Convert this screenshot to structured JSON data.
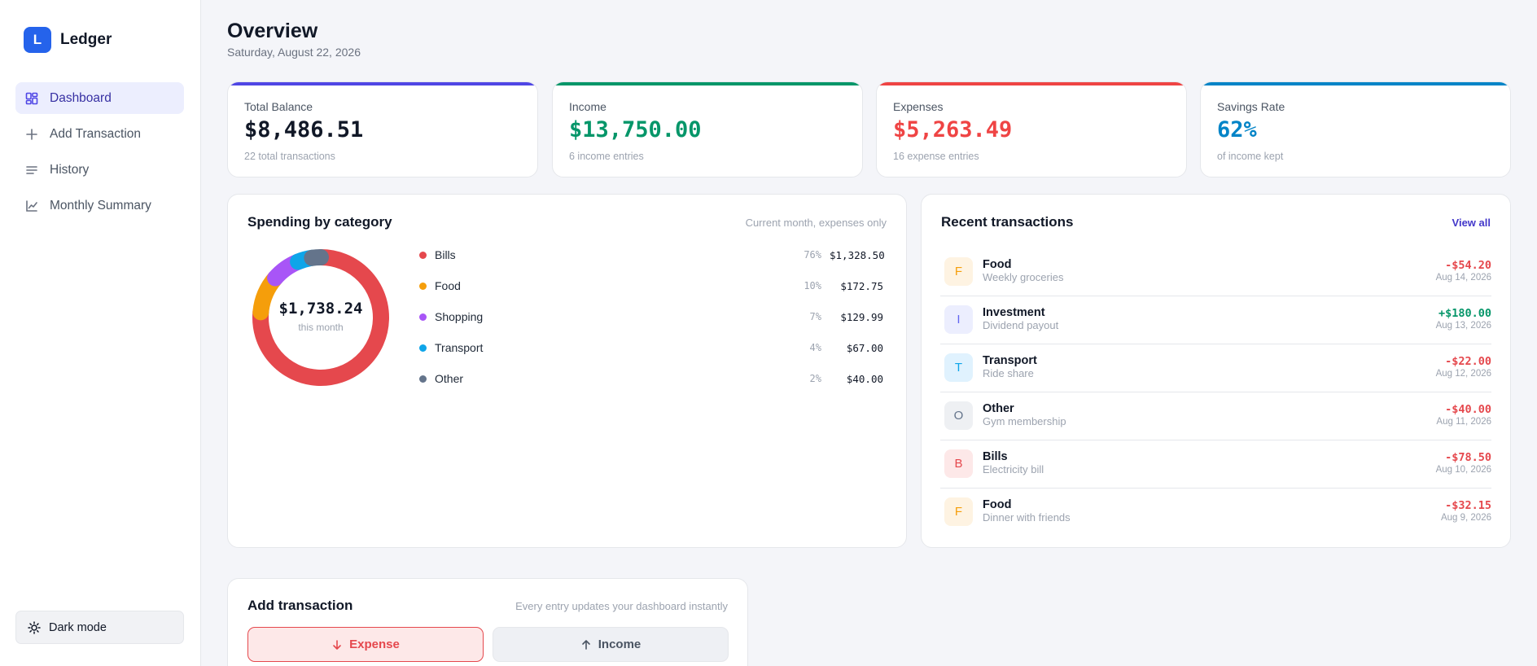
{
  "app": {
    "logo_letter": "L",
    "name": "Ledger"
  },
  "nav": {
    "items": [
      {
        "label": "Dashboard",
        "icon": "dashboard-icon",
        "active": true
      },
      {
        "label": "Add Transaction",
        "icon": "plus-icon",
        "active": false
      },
      {
        "label": "History",
        "icon": "list-icon",
        "active": false
      },
      {
        "label": "Monthly Summary",
        "icon": "chart-icon",
        "active": false
      }
    ],
    "dark_mode_label": "Dark mode"
  },
  "header": {
    "title": "Overview",
    "date": "Saturday, August 22, 2026"
  },
  "stats": [
    {
      "label": "Total Balance",
      "value": "$8,486.51",
      "sub": "22 total transactions",
      "accent": "#4f46e5",
      "value_color": "#111827"
    },
    {
      "label": "Income",
      "value": "$13,750.00",
      "sub": "6 income entries",
      "accent": "#059669",
      "value_color": "#059669"
    },
    {
      "label": "Expenses",
      "value": "$5,263.49",
      "sub": "16 expense entries",
      "accent": "#ef4444",
      "value_color": "#ef4444"
    },
    {
      "label": "Savings Rate",
      "value": "62%",
      "sub": "of income kept",
      "accent": "#0284c7",
      "value_color": "#0284c7"
    }
  ],
  "spending": {
    "title": "Spending by category",
    "note": "Current month, expenses only",
    "total": "$1,738.24",
    "total_sub": "this month"
  },
  "chart_data": {
    "type": "pie",
    "title": "Spending by category",
    "categories": [
      "Bills",
      "Food",
      "Shopping",
      "Transport",
      "Other"
    ],
    "values": [
      1328.5,
      172.75,
      129.99,
      67.0,
      40.0
    ],
    "amounts": [
      "$1,328.50",
      "$172.75",
      "$129.99",
      "$67.00",
      "$40.00"
    ],
    "percents": [
      "76%",
      "10%",
      "7%",
      "4%",
      "2%"
    ],
    "colors": [
      "#e5484d",
      "#f59e0b",
      "#a855f7",
      "#0ea5e9",
      "#64748b"
    ],
    "center_label": "$1,738.24",
    "legend_position": "right"
  },
  "recent": {
    "title": "Recent transactions",
    "view_all": "View all",
    "items": [
      {
        "letter": "F",
        "name": "Food",
        "desc": "Weekly groceries",
        "amount": "-$54.20",
        "date": "Aug 14, 2026",
        "type": "expense",
        "avatar_bg": "#fef3e2",
        "avatar_fg": "#f59e0b"
      },
      {
        "letter": "I",
        "name": "Investment",
        "desc": "Dividend payout",
        "amount": "+$180.00",
        "date": "Aug 13, 2026",
        "type": "income",
        "avatar_bg": "#eceefe",
        "avatar_fg": "#6366f1"
      },
      {
        "letter": "T",
        "name": "Transport",
        "desc": "Ride share",
        "amount": "-$22.00",
        "date": "Aug 12, 2026",
        "type": "expense",
        "avatar_bg": "#e0f2fe",
        "avatar_fg": "#0ea5e9"
      },
      {
        "letter": "O",
        "name": "Other",
        "desc": "Gym membership",
        "amount": "-$40.00",
        "date": "Aug 11, 2026",
        "type": "expense",
        "avatar_bg": "#eef0f3",
        "avatar_fg": "#64748b"
      },
      {
        "letter": "B",
        "name": "Bills",
        "desc": "Electricity bill",
        "amount": "-$78.50",
        "date": "Aug 10, 2026",
        "type": "expense",
        "avatar_bg": "#fde8e8",
        "avatar_fg": "#e5484d"
      },
      {
        "letter": "F",
        "name": "Food",
        "desc": "Dinner with friends",
        "amount": "-$32.15",
        "date": "Aug 9, 2026",
        "type": "expense",
        "avatar_bg": "#fef3e2",
        "avatar_fg": "#f59e0b"
      }
    ]
  },
  "add_tx": {
    "title": "Add transaction",
    "note": "Every entry updates your dashboard instantly",
    "expense_label": "Expense",
    "income_label": "Income"
  },
  "colors": {
    "expense": "#e5484d",
    "income": "#059669",
    "accent": "#4f46e5"
  }
}
